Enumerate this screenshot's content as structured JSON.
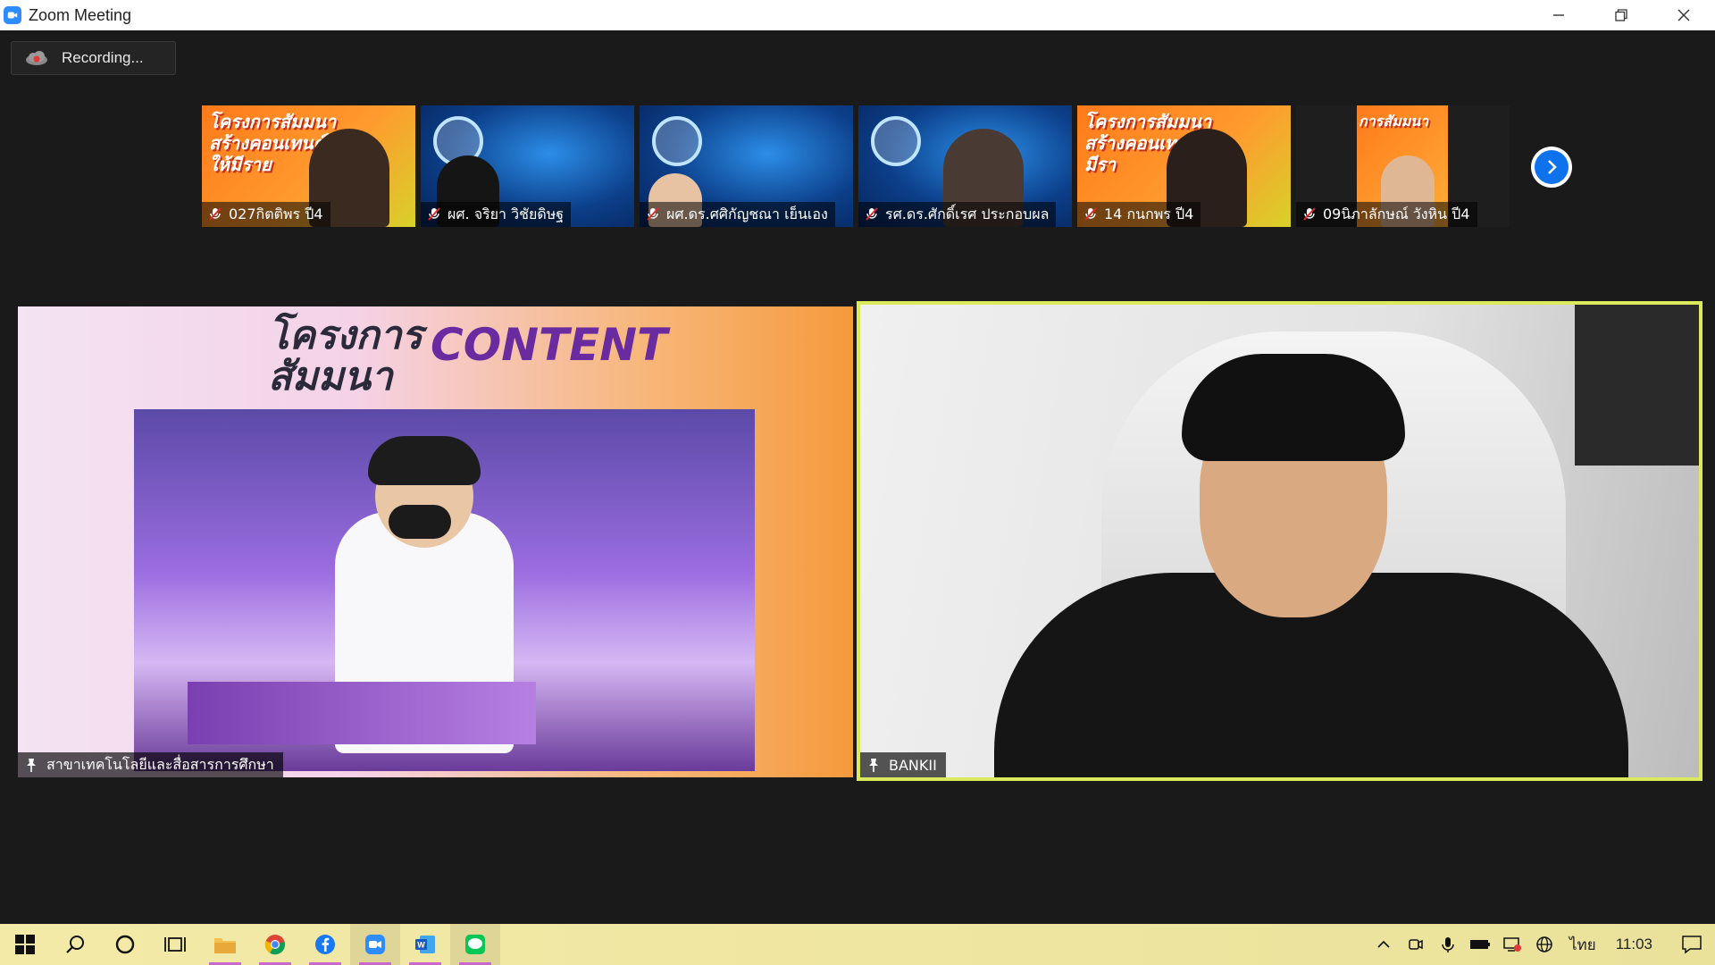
{
  "window": {
    "title": "Zoom Meeting"
  },
  "recording": {
    "label": "Recording..."
  },
  "thumbnails": [
    {
      "name": "027กิตติพร ปี4",
      "banner": "โครงการสัมมนา สร้างคอนเทนต์ ให้มีราย",
      "bg": "orange",
      "person_color": "#3a2a20"
    },
    {
      "name": "ผศ. จริยา วิชัยดิษฐ",
      "banner": "",
      "bg": "blue",
      "person_color": "#151515"
    },
    {
      "name": "ผศ.ดร.ศศิกัญชณา เย็นเอง",
      "banner": "",
      "bg": "blue",
      "person_color": "#e8c3a3"
    },
    {
      "name": "รศ.ดร.ศักดิ์เรศ ประกอบผล",
      "banner": "",
      "bg": "blue",
      "person_color": "#4a3a34"
    },
    {
      "name": "14 กนกพร ปี4",
      "banner": "โครงการสัมมนา สร้างคอนเทน ให้มีรา",
      "bg": "orange",
      "person_color": "#2a1f1a"
    },
    {
      "name": "09นิภาลักษณ์ วังหิน ปี4",
      "banner": "การสัมมนา",
      "bg": "dark",
      "person_color": "#e0b794"
    }
  ],
  "main_videos": {
    "left": {
      "name": "สาขาเทคโนโลยีและสื่อสารการศึกษา",
      "headline_line1": "โครงการ",
      "headline_line2": "สัมมนา",
      "headline_brand": "CONTENT"
    },
    "right": {
      "name": "BANKII"
    }
  },
  "taskbar": {
    "language": "ไทย",
    "time": "11:03"
  },
  "colors": {
    "active_speaker_border": "#d9ea5a",
    "zoom_blue": "#0e72ed",
    "taskbar_bg": "#f4eaa8"
  }
}
